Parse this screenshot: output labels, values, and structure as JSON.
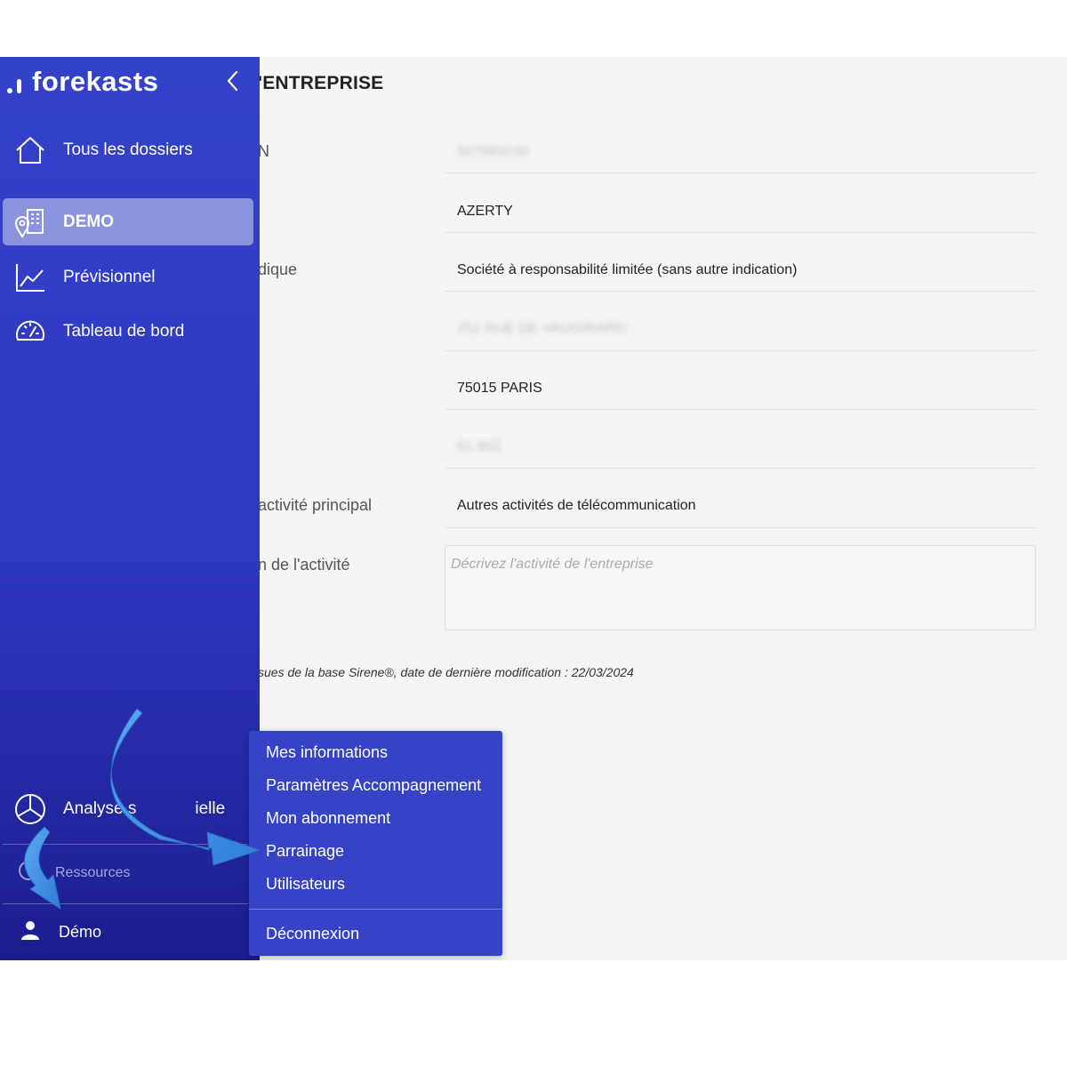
{
  "brand": {
    "name": "forekasts"
  },
  "sidebar": {
    "items": [
      {
        "label": "Tous les dossiers",
        "icon": "home-icon"
      },
      {
        "label": "DEMO",
        "icon": "building-pin-icon",
        "active": true
      },
      {
        "label": "Prévisionnel",
        "icon": "line-chart-icon"
      },
      {
        "label": "Tableau de bord",
        "icon": "gauge-icon"
      }
    ],
    "analysis": {
      "label": "Analyse sectorielle",
      "visible_left": "Analyse s",
      "visible_right": "ielle",
      "icon": "pie-chart-icon"
    },
    "resources": {
      "label": "Ressources",
      "icon": "help-circle-icon"
    },
    "user": {
      "label": "Démo",
      "icon": "user-icon"
    }
  },
  "main": {
    "title": "'ENTREPRISE",
    "rows": [
      {
        "label": "N",
        "value": "507093230",
        "blurred": true
      },
      {
        "label": "",
        "value": "AZERTY"
      },
      {
        "label": "dique",
        "value": "Société à responsabilité limitée (sans autre indication)"
      },
      {
        "label": "",
        "value": "252 RUE DE VAUGIRARD",
        "blurred": true
      },
      {
        "label": "",
        "value": "75015 PARIS"
      },
      {
        "label": "",
        "value": "61.90Z",
        "blurred": true
      },
      {
        "label": "activité principal",
        "value": "Autres activités de télécommunication"
      }
    ],
    "description": {
      "label": "n de l'activité",
      "placeholder": "Décrivez l'activité de l'entreprise"
    },
    "source_note": "sues de la base Sirene®, date de dernière modification : 22/03/2024"
  },
  "user_menu": {
    "items": [
      "Mes informations",
      "Paramètres Accompagnement",
      "Mon abonnement",
      "Parrainage",
      "Utilisateurs"
    ],
    "logout": "Déconnexion"
  },
  "colors": {
    "sidebar": "#3442c9",
    "active_item": "#8b93dc",
    "menu": "#3643c6",
    "arrow": "#3d8fe0",
    "background": "#f5f5f5"
  }
}
